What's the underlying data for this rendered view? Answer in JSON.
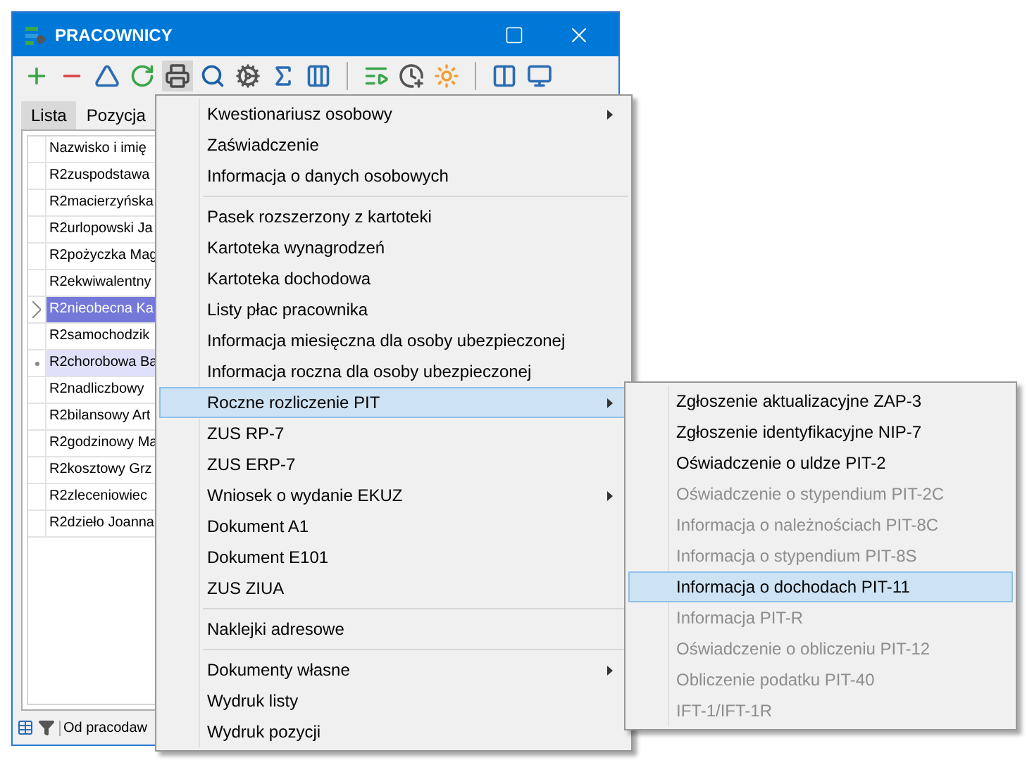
{
  "window": {
    "title": "PRACOWNICY"
  },
  "tabs": [
    {
      "label": "Lista",
      "selected": true
    },
    {
      "label": "Pozycja",
      "selected": false
    }
  ],
  "list": {
    "header": "Nazwisko i imię",
    "rows": [
      {
        "name": "R2zuspodstawa",
        "selected": false,
        "current": false
      },
      {
        "name": "R2macierzyńska",
        "selected": false,
        "current": false
      },
      {
        "name": "R2urlopowski Ja",
        "selected": false,
        "current": false
      },
      {
        "name": "R2pożyczka Mag",
        "selected": false,
        "current": false
      },
      {
        "name": "R2ekwiwalentny",
        "selected": false,
        "current": false
      },
      {
        "name": "R2nieobecna Ka",
        "selected": true,
        "current": true
      },
      {
        "name": "R2samochodzik",
        "selected": false,
        "current": false
      },
      {
        "name": "R2chorobowa Ba",
        "selected": true,
        "current": false
      },
      {
        "name": "R2nadliczbowy",
        "selected": false,
        "current": false
      },
      {
        "name": "R2bilansowy Art",
        "selected": false,
        "current": false
      },
      {
        "name": "R2godzinowy Ma",
        "selected": false,
        "current": false
      },
      {
        "name": "R2kosztowy Grz",
        "selected": false,
        "current": false
      },
      {
        "name": "R2zleceniowiec",
        "selected": false,
        "current": false
      },
      {
        "name": "R2dzieło Joanna",
        "selected": false,
        "current": false
      }
    ]
  },
  "status_bar": {
    "filter_label": "Od pracodaw"
  },
  "context_menu": {
    "items": [
      {
        "kind": "item",
        "label": "Kwestionariusz osobowy",
        "submenu": true,
        "selected": false
      },
      {
        "kind": "item",
        "label": "Zaświadczenie",
        "submenu": false,
        "selected": false
      },
      {
        "kind": "item",
        "label": "Informacja o danych osobowych",
        "submenu": false,
        "selected": false
      },
      {
        "kind": "separator"
      },
      {
        "kind": "item",
        "label": "Pasek rozszerzony z kartoteki",
        "submenu": false,
        "selected": false
      },
      {
        "kind": "item",
        "label": "Kartoteka wynagrodzeń",
        "submenu": false,
        "selected": false
      },
      {
        "kind": "item",
        "label": "Kartoteka dochodowa",
        "submenu": false,
        "selected": false
      },
      {
        "kind": "item",
        "label": "Listy płac pracownika",
        "submenu": false,
        "selected": false
      },
      {
        "kind": "item",
        "label": "Informacja miesięczna dla osoby ubezpieczonej",
        "submenu": false,
        "selected": false
      },
      {
        "kind": "item",
        "label": "Informacja roczna dla osoby ubezpieczonej",
        "submenu": false,
        "selected": false
      },
      {
        "kind": "item",
        "label": "Roczne rozliczenie PIT",
        "submenu": true,
        "selected": true
      },
      {
        "kind": "item",
        "label": "ZUS RP-7",
        "submenu": false,
        "selected": false
      },
      {
        "kind": "item",
        "label": "ZUS ERP-7",
        "submenu": false,
        "selected": false
      },
      {
        "kind": "item",
        "label": "Wniosek o wydanie EKUZ",
        "submenu": true,
        "selected": false
      },
      {
        "kind": "item",
        "label": "Dokument A1",
        "submenu": false,
        "selected": false
      },
      {
        "kind": "item",
        "label": "Dokument E101",
        "submenu": false,
        "selected": false
      },
      {
        "kind": "item",
        "label": "ZUS ZIUA",
        "submenu": false,
        "selected": false
      },
      {
        "kind": "separator"
      },
      {
        "kind": "item",
        "label": "Naklejki adresowe",
        "submenu": false,
        "selected": false
      },
      {
        "kind": "separator"
      },
      {
        "kind": "item",
        "label": "Dokumenty własne",
        "submenu": true,
        "selected": false
      },
      {
        "kind": "item",
        "label": "Wydruk listy",
        "submenu": false,
        "selected": false
      },
      {
        "kind": "item",
        "label": "Wydruk pozycji",
        "submenu": false,
        "selected": false
      }
    ]
  },
  "submenu": {
    "items": [
      {
        "label": "Zgłoszenie aktualizacyjne ZAP-3",
        "disabled": false,
        "selected": false
      },
      {
        "label": "Zgłoszenie identyfikacyjne NIP-7",
        "disabled": false,
        "selected": false
      },
      {
        "label": "Oświadczenie o uldze PIT-2",
        "disabled": false,
        "selected": false
      },
      {
        "label": "Oświadczenie o stypendium PIT-2C",
        "disabled": true,
        "selected": false
      },
      {
        "label": "Informacja o należnościach PIT-8C",
        "disabled": true,
        "selected": false
      },
      {
        "label": "Informacja o stypendium PIT-8S",
        "disabled": true,
        "selected": false
      },
      {
        "label": "Informacja o dochodach PIT-11",
        "disabled": false,
        "selected": true
      },
      {
        "label": "Informacja PIT-R",
        "disabled": true,
        "selected": false
      },
      {
        "label": "Oświadczenie o obliczeniu PIT-12",
        "disabled": true,
        "selected": false
      },
      {
        "label": "Obliczenie podatku PIT-40",
        "disabled": true,
        "selected": false
      },
      {
        "label": "IFT-1/IFT-1R",
        "disabled": true,
        "selected": false
      }
    ]
  }
}
